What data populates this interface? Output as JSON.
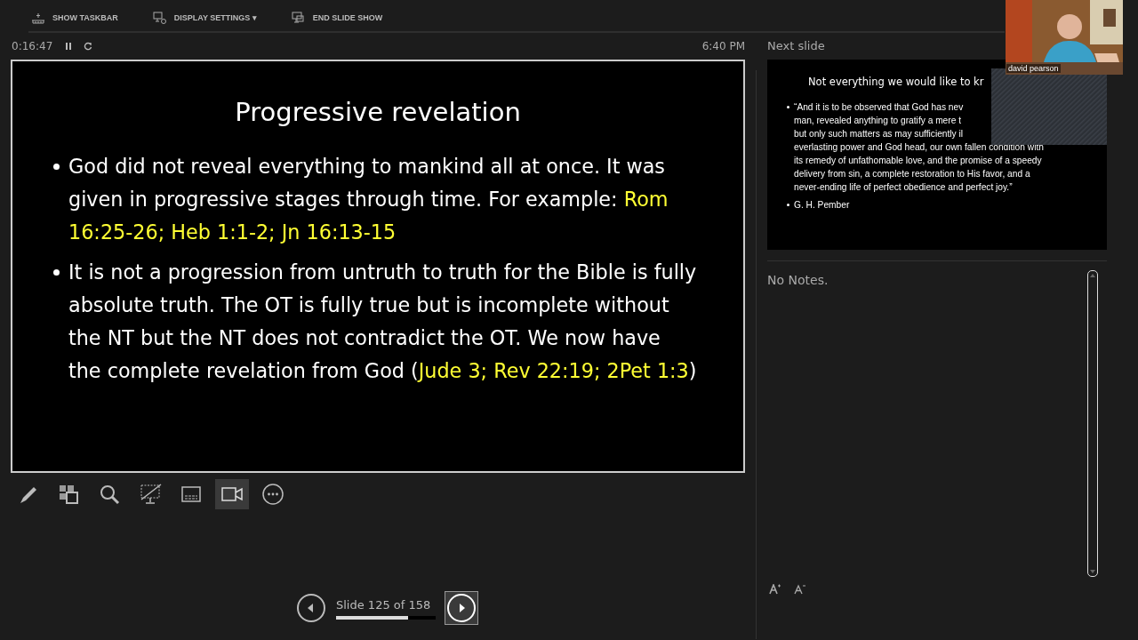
{
  "top_bar": {
    "items": [
      {
        "kind": "taskbar",
        "label": "SHOW TASKBAR"
      },
      {
        "kind": "display",
        "label": "DISPLAY SETTINGS ▾"
      },
      {
        "kind": "end",
        "label": "END SLIDE SHOW"
      }
    ]
  },
  "timer": {
    "elapsed": "0:16:47",
    "clock": "6:40 PM"
  },
  "current_slide": {
    "title": "Progressive revelation",
    "bullets": [
      [
        {
          "text": "God did not reveal everything to mankind all at once. It was given in progressive stages through time. For example: ",
          "highlight": false
        },
        {
          "text": "Rom 16:25-26; Heb 1:1-2; Jn 16:13-15",
          "highlight": true
        }
      ],
      [
        {
          "text": "It is not a progression from untruth to truth for the Bible is fully absolute truth. The OT is fully true but is incomplete without the NT but the NT does not contradict the OT. We now have the complete revelation from God (",
          "highlight": false
        },
        {
          "text": "Jude 3; Rev 22:19; 2Pet 1:3",
          "highlight": true
        },
        {
          "text": ")",
          "highlight": false
        }
      ]
    ]
  },
  "tools": [
    {
      "kind": "pen",
      "selected": false
    },
    {
      "kind": "slides",
      "selected": false
    },
    {
      "kind": "zoom",
      "selected": false
    },
    {
      "kind": "blackout",
      "selected": false
    },
    {
      "kind": "subtitles",
      "selected": false
    },
    {
      "kind": "camera",
      "selected": true
    },
    {
      "kind": "more",
      "selected": false
    }
  ],
  "navigation": {
    "counter": "Slide 125 of 158",
    "level": 0.72
  },
  "next_slide": {
    "heading": "Next slide",
    "title": "Not everything we would like to kr",
    "bullets": [
      {
        "lines": [
          "“And it is to be observed that God has nev",
          "man, revealed anything to gratify a mere t",
          "but only such matters as may sufficiently il",
          "everlasting power and God head, our own fallen condition with",
          "its remedy of unfathomable love, and the promise of a speedy",
          "delivery from sin, a complete restoration to His favor, and a",
          "never-ending life of perfect obedience and perfect joy.”"
        ]
      },
      {
        "lines": [
          "G. H. Pember"
        ]
      }
    ]
  },
  "notes": {
    "text": "No Notes."
  },
  "video": {
    "kind": "picture",
    "participant": "david pearson"
  }
}
